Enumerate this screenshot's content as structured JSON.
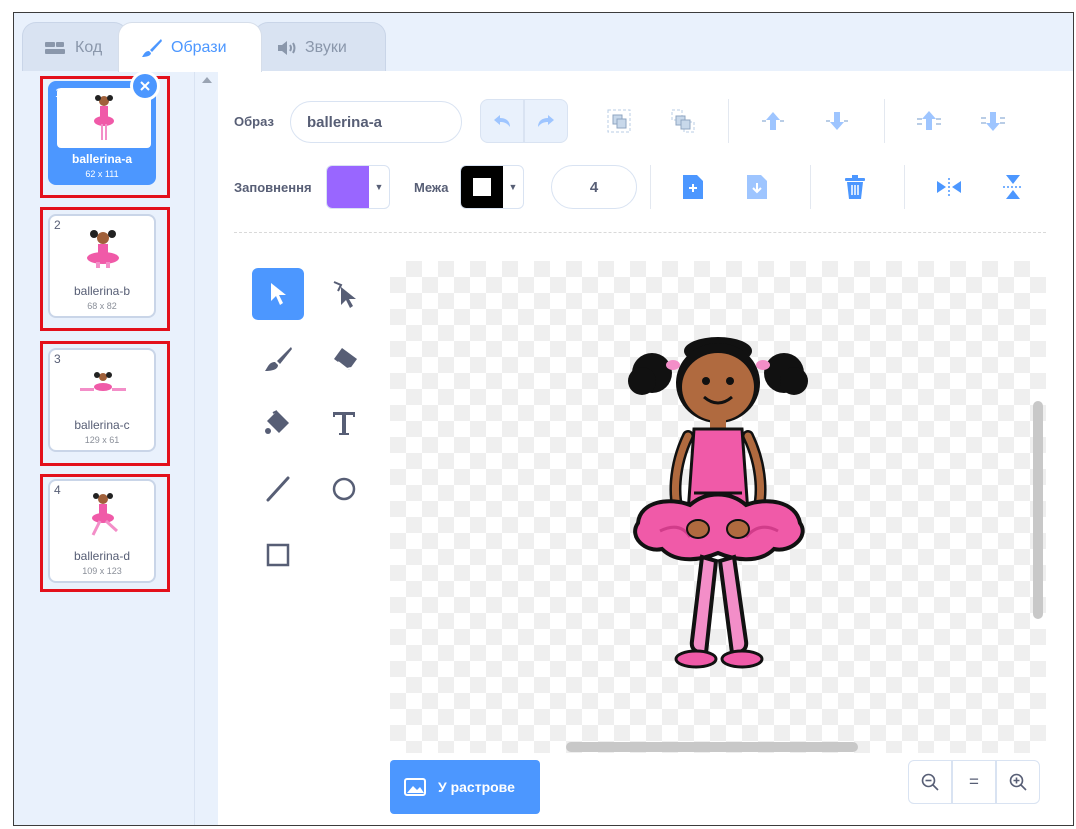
{
  "tabs": [
    {
      "label": "Код",
      "icon": "code-icon"
    },
    {
      "label": "Образи",
      "icon": "brush-icon"
    },
    {
      "label": "Звуки",
      "icon": "speaker-icon"
    }
  ],
  "costumes": [
    {
      "number": "1",
      "name": "ballerina-a",
      "size": "62 x 111",
      "selected": true
    },
    {
      "number": "2",
      "name": "ballerina-b",
      "size": "68 x 82",
      "selected": false
    },
    {
      "number": "3",
      "name": "ballerina-c",
      "size": "129 x 61",
      "selected": false
    },
    {
      "number": "4",
      "name": "ballerina-d",
      "size": "109 x 123",
      "selected": false
    }
  ],
  "toolbar": {
    "costume_label": "Образ",
    "costume_name": "ballerina-a",
    "fill_label": "Заповнення",
    "fill_color": "#9966ff",
    "outline_label": "Межа",
    "outline_color": "#000000",
    "outline_width": "4"
  },
  "bitmap_button": "У растрове",
  "zoom": {
    "out": "−",
    "reset": "=",
    "in": "+"
  },
  "colors": {
    "accent": "#4c97ff",
    "highlight": "#e3101b"
  }
}
